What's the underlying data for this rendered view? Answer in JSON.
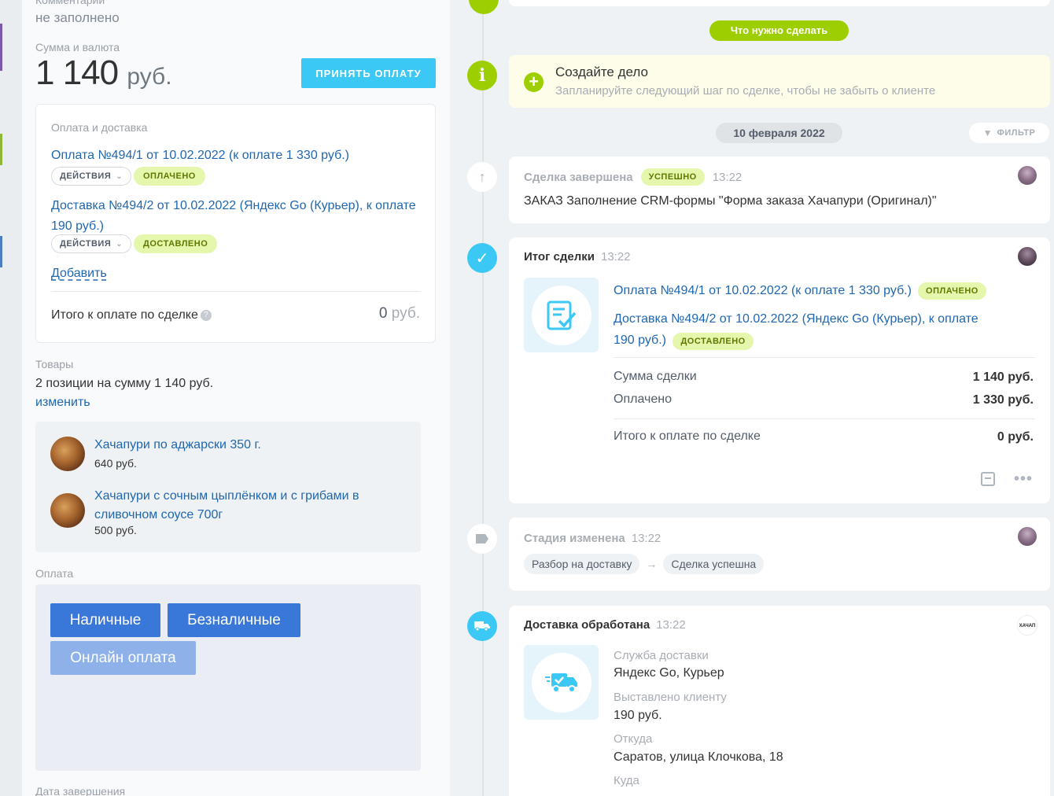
{
  "left": {
    "comment_label": "Комментарий",
    "comment_value": "не заполнено",
    "sum_label": "Сумма и валюта",
    "sum_amount": "1 140",
    "sum_currency": "руб.",
    "accept_payment_button": "ПРИНЯТЬ ОПЛАТУ",
    "payment_delivery": {
      "title": "Оплата и доставка",
      "payment_link": "Оплата №494/1 от 10.02.2022 (к оплате 1 330 руб.)",
      "payment_actions": "ДЕЙСТВИЯ",
      "payment_status": "ОПЛАЧЕНО",
      "delivery_link_line1": "Доставка №494/2 от 10.02.2022 (Яндекс Go (Курьер), к оплате",
      "delivery_link_line2": "190 руб.)",
      "delivery_actions": "ДЕЙСТВИЯ",
      "delivery_status": "ДОСТАВЛЕНО",
      "add_link": "Добавить",
      "total_label": "Итого к оплате по сделке",
      "total_value": "0",
      "total_currency": "руб."
    },
    "goods": {
      "label": "Товары",
      "summary": "2 позиции на сумму 1 140 руб.",
      "change_link": "изменить",
      "items": [
        {
          "name_line1": "Хачапури по аджарски 350 г.",
          "name_line2": "",
          "price": "640 руб."
        },
        {
          "name_line1": "Хачапури с сочным цыплёнком и с грибами в",
          "name_line2": "сливочном соусе 700г",
          "price": "500 руб."
        }
      ]
    },
    "payment": {
      "label": "Оплата",
      "cash": "Наличные",
      "cashless": "Безналичные",
      "online": "Онлайн оплата"
    },
    "completion_label": "Дата завершения"
  },
  "timeline": {
    "todo_pill": "Что нужно сделать",
    "create_task": {
      "title": "Создайте дело",
      "subtitle": "Запланируйте следующий шаг по сделке, чтобы не забыть о клиенте"
    },
    "date_pill": "10 февраля 2022",
    "filter_button": "ФИЛЬТР",
    "deal_closed": {
      "title": "Сделка завершена",
      "badge": "УСПЕШНО",
      "time": "13:22",
      "text": "ЗАКАЗ Заполнение CRM-формы \"Форма заказа Хачапури (Оригинал)\""
    },
    "deal_result": {
      "title": "Итог сделки",
      "time": "13:22",
      "payment_link": "Оплата №494/1 от 10.02.2022 (к оплате 1 330 руб.)",
      "payment_badge": "ОПЛАЧЕНО",
      "delivery_link_line1": "Доставка №494/2 от 10.02.2022 (Яндекс Go (Курьер), к оплате",
      "delivery_link_line2": "190 руб.)",
      "delivery_badge": "ДОСТАВЛЕНО",
      "deal_sum_label": "Сумма сделки",
      "deal_sum_value": "1 140 руб.",
      "paid_label": "Оплачено",
      "paid_value": "1 330 руб.",
      "total_label": "Итого к оплате по сделке",
      "total_value": "0 руб."
    },
    "stage_changed": {
      "title": "Стадия изменена",
      "time": "13:22",
      "from": "Разбор на доставку",
      "arrow": "→",
      "to": "Сделка успешна"
    },
    "delivery_processed": {
      "title": "Доставка обработана",
      "time": "13:22",
      "logo_text": "ХАЧАП",
      "service_label": "Служба доставки",
      "service_value": "Яндекс Go, Курьер",
      "billed_label": "Выставлено клиенту",
      "billed_value": "190 руб.",
      "from_label": "Откуда",
      "from_value": "Саратов, улица Клочкова, 18",
      "to_label": "Куда"
    }
  },
  "colors": {
    "accent_blue": "#3bc8f5",
    "link_blue": "#2067b0",
    "green": "#9dcf00",
    "pay_button": "#3977d8"
  }
}
